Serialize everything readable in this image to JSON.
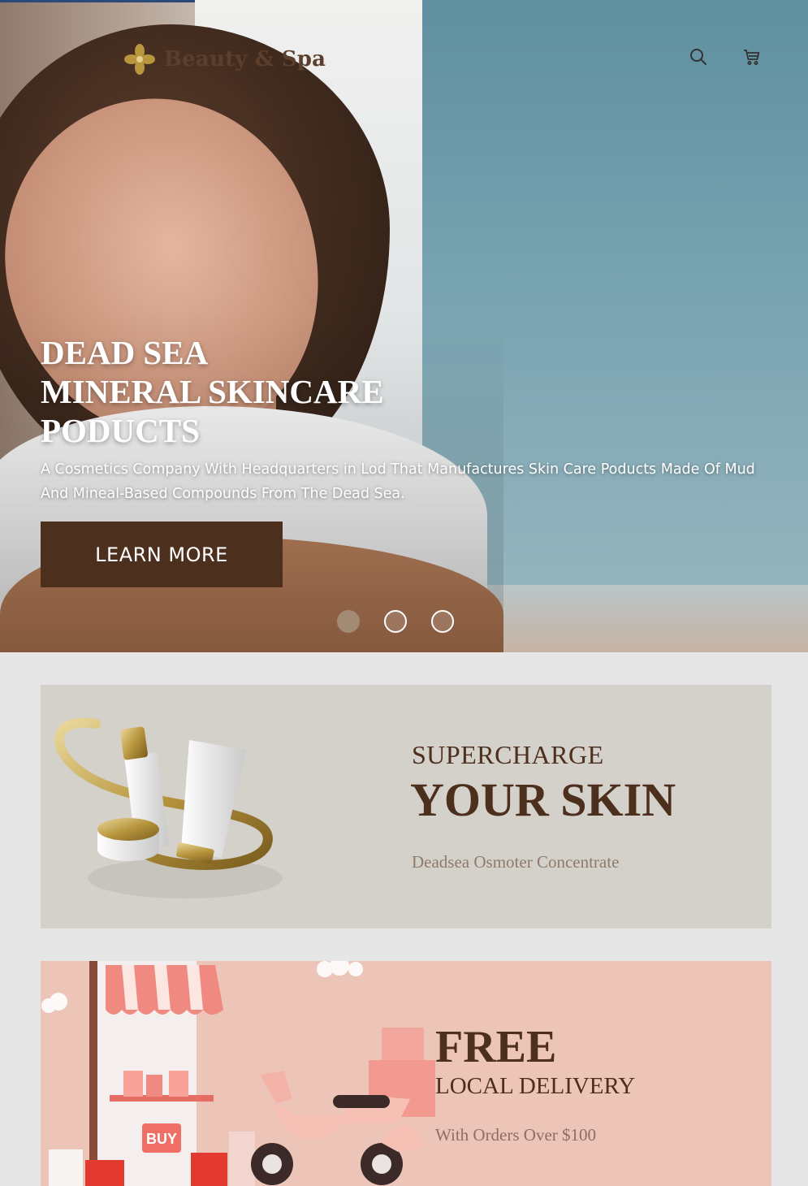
{
  "header": {
    "logo_text": "Beauty & Spa",
    "icons": [
      "search-icon",
      "cart-icon"
    ]
  },
  "hero": {
    "title_lines": [
      "DEAD SEA",
      "MINERAL SKINCARE",
      "PODUCTS"
    ],
    "subtitle": "A Cosmetics Company With Headquarters in Lod That Manufactures Skin Care Poducts Made Of Mud And Mineal-Based Compounds From The Dead Sea.",
    "cta_label": "LEARN MORE",
    "slides_total": 3,
    "active_slide": 1
  },
  "promo_skin": {
    "eyebrow": "SUPERCHARGE",
    "headline": "YOUR SKIN",
    "tagline": "Deadsea Osmoter Concentrate"
  },
  "promo_delivery": {
    "headline": "FREE",
    "subheadline": "LOCAL DELIVERY",
    "tagline": "With Orders Over $100",
    "sign_text": "BUY"
  },
  "colors": {
    "brand_brown": "#4d2f1d",
    "logo_gold": "#b8963e",
    "card_beige": "#d4d1cb",
    "card_pink": "#edc5b8",
    "page_bg": "#e6e6e6"
  }
}
